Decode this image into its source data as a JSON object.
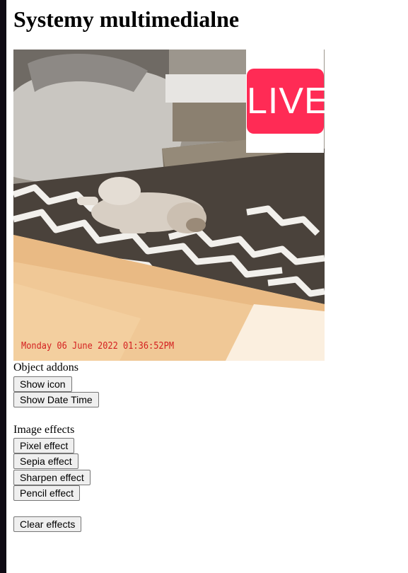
{
  "page": {
    "title": "Systemy multimedialne"
  },
  "video": {
    "overlay_live_text": "LIVE",
    "timestamp": "Monday 06 June 2022 01:36:52PM"
  },
  "addons": {
    "label": "Object addons",
    "show_icon": "Show icon",
    "show_datetime": "Show Date Time"
  },
  "effects": {
    "label": "Image effects",
    "pixel": "Pixel effect",
    "sepia": "Sepia effect",
    "sharpen": "Sharpen effect",
    "pencil": "Pencil effect",
    "clear": "Clear effects"
  },
  "colors": {
    "live_badge": "#ff2b55",
    "timestamp_text": "#d42020",
    "left_bar": "#0f0a14"
  }
}
